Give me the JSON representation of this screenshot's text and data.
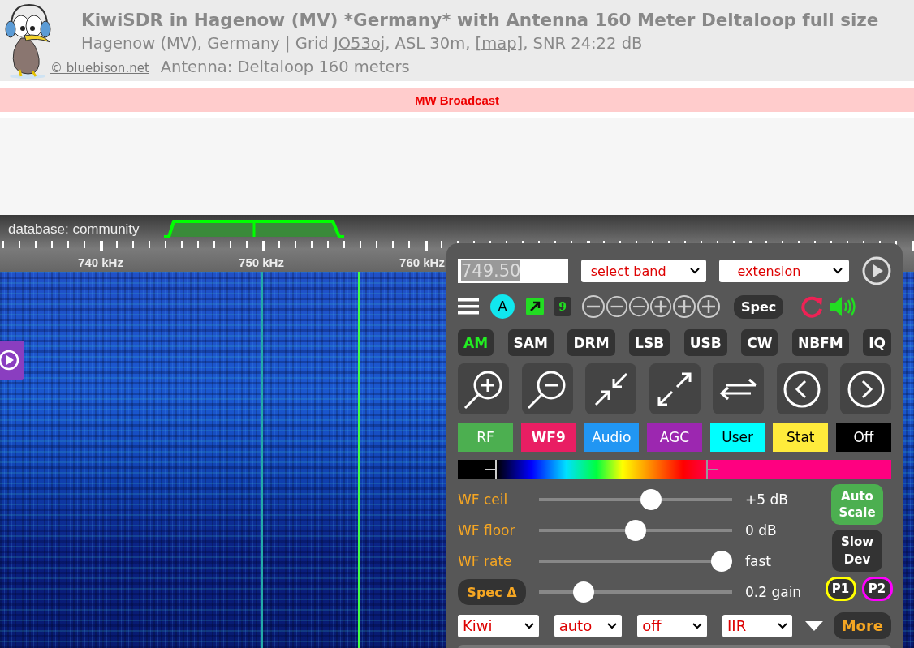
{
  "header": {
    "title": "KiwiSDR in Hagenow (MV) *Germany* with Antenna 160 Meter Deltaloop full size",
    "location": {
      "before": "Hagenow (MV), Germany | Grid ",
      "grid_link": "JO53oj",
      "middle": ", ASL 30m, ",
      "map_link": "[map]",
      "after": ", SNR 24:22 dB"
    },
    "credit_link": "© bluebison.net",
    "antenna": "Antenna: Deltaloop 160 meters"
  },
  "band_bar": {
    "label": "MW Broadcast"
  },
  "scale": {
    "database_label": "database: community",
    "labels": [
      "740 kHz",
      "750 kHz",
      "760 kHz"
    ]
  },
  "controls": {
    "frequency": "749.50",
    "band_select": "select band",
    "extension_select": "extension",
    "user_badge": "A",
    "zoom_level": "9",
    "spec_button": "Spec",
    "modes": [
      {
        "label": "AM",
        "selected": true
      },
      {
        "label": "SAM",
        "selected": false
      },
      {
        "label": "DRM",
        "selected": false
      },
      {
        "label": "LSB",
        "selected": false
      },
      {
        "label": "USB",
        "selected": false
      },
      {
        "label": "CW",
        "selected": false
      },
      {
        "label": "NBFM",
        "selected": false
      },
      {
        "label": "IQ",
        "selected": false
      }
    ],
    "tabs": [
      {
        "label": "RF",
        "color": "#4caf50",
        "selected": false
      },
      {
        "label": "WF9",
        "color": "#e91e63",
        "selected": true
      },
      {
        "label": "Audio",
        "color": "#2196f3",
        "selected": false
      },
      {
        "label": "AGC",
        "color": "#9c27b0",
        "selected": false
      },
      {
        "label": "User",
        "color": "#00ffff",
        "selected": false
      },
      {
        "label": "Stat",
        "color": "#ffeb3b",
        "selected": false
      },
      {
        "label": "Off",
        "color": "#000000",
        "selected": false
      }
    ],
    "sliders": [
      {
        "kind": "label",
        "label": "WF ceil",
        "level": 0.58,
        "reading": "+5 dB"
      },
      {
        "kind": "label",
        "label": "WF floor",
        "level": 0.5,
        "reading": "0 dB"
      },
      {
        "kind": "label",
        "label": "WF rate",
        "level": 0.945,
        "reading": "fast"
      },
      {
        "kind": "button",
        "label": "Spec Δ",
        "level": 0.23,
        "reading": "0.2 gain"
      }
    ],
    "auto_scale": "Auto Scale",
    "slow_dev": "Slow Dev",
    "presets": [
      {
        "label": "P1",
        "color": "#ffff00"
      },
      {
        "label": "P2",
        "color": "#ff00ff"
      }
    ],
    "bottom_selects": [
      "Kiwi",
      "auto",
      "off",
      "IIR"
    ],
    "more_button": "More"
  }
}
